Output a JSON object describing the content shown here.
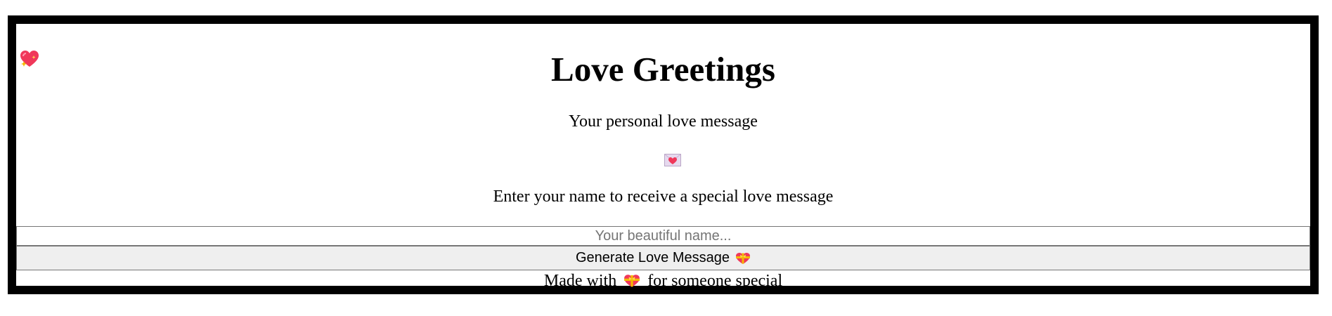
{
  "page": {
    "title": "Love Greetings",
    "subtitle": "Your personal love message",
    "prompt": "Enter your name to receive a special love message"
  },
  "form": {
    "name_placeholder": "Your beautiful name...",
    "name_value": "",
    "generate_label": "Generate Love Message"
  },
  "footer": {
    "prefix": "Made with",
    "suffix": "for someone special"
  },
  "icons": {
    "corner": "sparkling-heart-icon",
    "envelope": "love-letter-icon",
    "button": "heart-with-ribbon-icon",
    "footer": "heart-with-ribbon-icon"
  },
  "colors": {
    "frame": "#000000",
    "heart": "#f0385a",
    "ribbon": "#f5b800",
    "button_bg": "#efefef"
  }
}
